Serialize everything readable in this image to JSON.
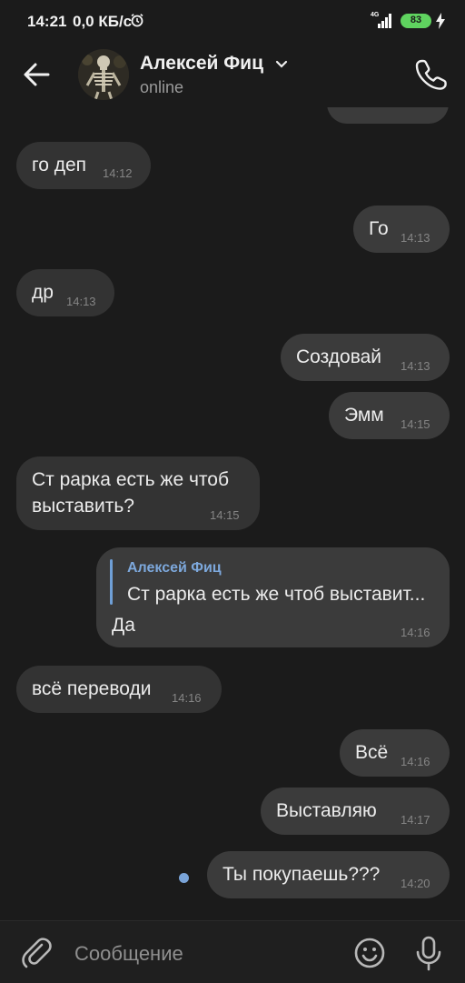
{
  "status_bar": {
    "time": "14:21",
    "net_speed": "0,0 КБ/с",
    "network_type": "4G",
    "battery": "83",
    "battery_color": "#5fd35f"
  },
  "header": {
    "contact_name": "Алексей Фиц",
    "status": "online"
  },
  "messages": [
    {
      "dir": "in",
      "text": "го деп",
      "time": "14:12"
    },
    {
      "dir": "out",
      "text": "Го",
      "time": "14:13"
    },
    {
      "dir": "in",
      "text": "др",
      "time": "14:13"
    },
    {
      "dir": "out",
      "text": "Создовай",
      "time": "14:13"
    },
    {
      "dir": "out",
      "text": "Эмм",
      "time": "14:15"
    },
    {
      "dir": "in",
      "line1": "Ст рарка есть же чтоб",
      "line2": "выставить?",
      "time": "14:15"
    },
    {
      "dir": "out",
      "reply_author": "Алексей Фиц",
      "reply_text": "Ст рарка есть же чтоб выставит...",
      "text": "Да",
      "time": "14:16"
    },
    {
      "dir": "in",
      "text": "всё переводи",
      "time": "14:16"
    },
    {
      "dir": "out",
      "text": "Всё",
      "time": "14:16"
    },
    {
      "dir": "out",
      "text": "Выставляю",
      "time": "14:17"
    },
    {
      "dir": "out",
      "text": "Ты покупаешь???",
      "time": "14:20",
      "unread": true
    }
  ],
  "composer": {
    "placeholder": "Сообщение"
  },
  "colors": {
    "background": "#1b1b1b",
    "bubble_in": "#333333",
    "bubble_out": "#3b3b3b",
    "accent": "#7aa4d8"
  }
}
